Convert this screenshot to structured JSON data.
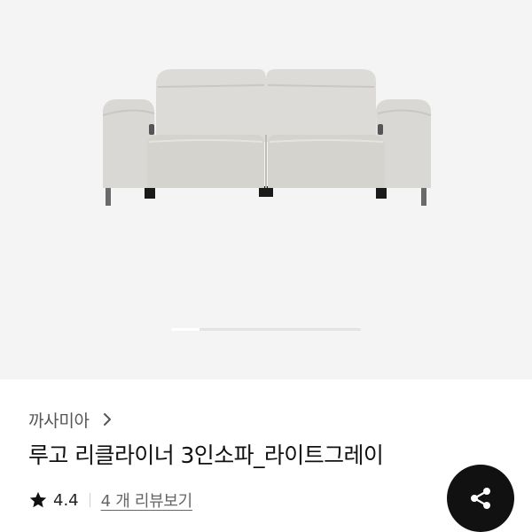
{
  "gallery": {
    "image_alt": "",
    "slide_progress": 0.15,
    "background_color": "#f4f4f4"
  },
  "product": {
    "brand": "까사미아",
    "title": "루고 리클라이너 3인소파_라이트그레이",
    "rating": "4.4",
    "review_link": "4 개 리뷰보기"
  },
  "icons": {
    "brand_chevron": "chevron-right-icon",
    "rating_star": "star-icon",
    "share": "share-icon"
  },
  "colors": {
    "share_button": "#111111",
    "text_primary": "#111111",
    "text_secondary": "#555555"
  }
}
